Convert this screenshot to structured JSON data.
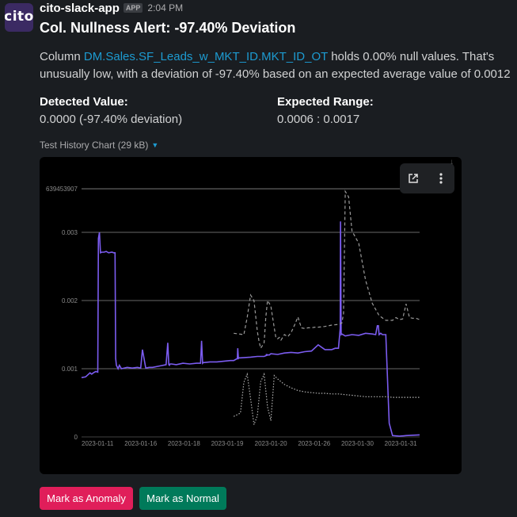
{
  "message": {
    "avatar_text": "cito",
    "sender": "cito-slack-app",
    "badge": "APP",
    "time": "2:04 PM",
    "title": "Col. Nullness Alert: -97.40% Deviation",
    "desc_prefix": "Column ",
    "desc_link": "DM.Sales.SF_Leads_w_MKT_ID.MKT_ID_OT",
    "desc_suffix": " holds 0.00% null values. That's unusually low, with a deviation of -97.40% based on an expected average value of 0.0012",
    "detected_label": "Detected Value:",
    "detected_value": "0.0000 (-97.40% deviation)",
    "expected_label": "Expected Range:",
    "expected_value": "0.0006 : 0.0017",
    "attachment_label": "Test History Chart (29 kB)",
    "colors": {
      "link": "#1d9bd1",
      "anomaly_button": "#e01e5a",
      "normal_button": "#007a5a"
    }
  },
  "chart_data": {
    "type": "line",
    "y_tick_labels": [
      "0",
      "0.001",
      "0.002",
      "0.003",
      "639453907"
    ],
    "y_ticks": [
      0,
      0.001,
      0.002,
      0.003,
      0.0036394539
    ],
    "x_tick_labels": [
      "2023-01-11",
      "2023-01-16",
      "2023-01-18",
      "2023-01-19",
      "2023-01-20",
      "2023-01-26",
      "2023-01-30",
      "2023-01-31"
    ],
    "ylim": [
      0,
      0.00364
    ],
    "grid": true,
    "series": [
      {
        "style": "solid",
        "color": "#7b5cf0",
        "x": [
          0,
          0.012,
          0.025,
          0.03,
          0.035,
          0.042,
          0.048,
          0.05,
          0.053,
          0.056,
          0.06,
          0.066,
          0.073,
          0.08,
          0.09,
          0.095,
          0.099,
          0.101,
          0.103,
          0.108,
          0.112,
          0.118,
          0.135,
          0.15,
          0.165,
          0.175,
          0.18,
          0.19,
          0.2,
          0.21,
          0.23,
          0.25,
          0.255,
          0.258,
          0.26,
          0.262,
          0.266,
          0.28,
          0.3,
          0.32,
          0.34,
          0.35,
          0.352,
          0.355,
          0.358,
          0.36,
          0.38,
          0.4,
          0.42,
          0.44,
          0.45,
          0.461,
          0.462,
          0.464,
          0.466,
          0.47,
          0.5,
          0.52,
          0.54,
          0.55,
          0.55,
          0.545,
          0.555,
          0.56,
          0.58,
          0.6,
          0.62,
          0.64,
          0.66,
          0.68,
          0.7,
          0.72,
          0.74,
          0.75,
          0.76,
          0.765,
          0.766,
          0.768,
          0.77,
          0.78,
          0.8,
          0.82,
          0.84,
          0.86,
          0.87,
          0.875,
          0.878,
          0.88,
          0.885,
          0.89,
          0.9,
          0.91,
          0.92,
          0.94,
          0.96,
          1.0
        ],
        "y": [
          0.00087,
          0.00088,
          0.00094,
          0.00092,
          0.00094,
          0.00096,
          0.00095,
          0.00291,
          0.003,
          0.0027,
          0.00271,
          0.00271,
          0.00272,
          0.0027,
          0.00271,
          0.0027,
          0.0027,
          0.00115,
          0.00105,
          0.001,
          0.00105,
          0.001,
          0.00102,
          0.00101,
          0.00102,
          0.00101,
          0.00128,
          0.00101,
          0.00102,
          0.00102,
          0.00104,
          0.00106,
          0.00138,
          0.00106,
          0.00105,
          0.00107,
          0.00107,
          0.00106,
          0.00108,
          0.00107,
          0.00108,
          0.00108,
          0.00108,
          0.00141,
          0.00108,
          0.00109,
          0.0011,
          0.0011,
          0.00111,
          0.00112,
          0.00112,
          0.00115,
          0.0013,
          0.00115,
          0.00116,
          0.00116,
          0.00117,
          0.00118,
          0.00118,
          0.0012,
          0.0012,
          0.00121,
          0.0012,
          0.00122,
          0.00121,
          0.00123,
          0.00124,
          0.00123,
          0.00125,
          0.00126,
          0.00135,
          0.00128,
          0.00128,
          0.0013,
          0.0013,
          0.00159,
          0.00316,
          0.0015,
          0.00151,
          0.00148,
          0.0015,
          0.00149,
          0.00152,
          0.00151,
          0.0015,
          0.00163,
          0.00163,
          0.0015,
          0.00152,
          0.0015,
          0.0015,
          0.0002,
          2e-05,
          1e-05,
          2e-05,
          3e-05
        ]
      },
      {
        "style": "dashed",
        "color": "#9a9a9a",
        "x": [
          0.45,
          0.48,
          0.49,
          0.5,
          0.51,
          0.52,
          0.525,
          0.53,
          0.54,
          0.545,
          0.55,
          0.56,
          0.57,
          0.575,
          0.58,
          0.585,
          0.59,
          0.6,
          0.61,
          0.62,
          0.63,
          0.64,
          0.65,
          0.66,
          0.67,
          0.68,
          0.69,
          0.7,
          0.72,
          0.74,
          0.76,
          0.77,
          0.775,
          0.78,
          0.79,
          0.8,
          0.82,
          0.84,
          0.86,
          0.88,
          0.9,
          0.92,
          0.93,
          0.94,
          0.95,
          0.96,
          0.97,
          0.98,
          0.99,
          1.0
        ],
        "y": [
          0.00152,
          0.0015,
          0.00175,
          0.00208,
          0.002,
          0.00155,
          0.0014,
          0.0013,
          0.00138,
          0.00175,
          0.002,
          0.00192,
          0.0016,
          0.00145,
          0.00144,
          0.00146,
          0.00142,
          0.0015,
          0.00147,
          0.00153,
          0.00164,
          0.00176,
          0.0016,
          0.00159,
          0.0016,
          0.0016,
          0.00161,
          0.00161,
          0.00162,
          0.00164,
          0.00165,
          0.00167,
          0.00181,
          0.0036,
          0.00352,
          0.00302,
          0.00284,
          0.0023,
          0.00196,
          0.00178,
          0.00171,
          0.00171,
          0.00175,
          0.00172,
          0.00173,
          0.00195,
          0.00175,
          0.00174,
          0.00174,
          0.00172
        ]
      },
      {
        "style": "dotted",
        "color": "#b0b0b0",
        "x": [
          0.45,
          0.47,
          0.48,
          0.49,
          0.5,
          0.51,
          0.52,
          0.53,
          0.54,
          0.55,
          0.56,
          0.57,
          0.58,
          0.6,
          0.62,
          0.64,
          0.66,
          0.68,
          0.7,
          0.72,
          0.74,
          0.76,
          0.78,
          0.8,
          0.82,
          0.84,
          0.86,
          0.88,
          0.9,
          0.92,
          0.94,
          0.96,
          0.98,
          1.0
        ],
        "y": [
          0.0003,
          0.00035,
          0.0008,
          0.00092,
          0.00056,
          0.00018,
          0.00031,
          0.00081,
          0.00092,
          0.00044,
          0.00024,
          0.0009,
          0.00085,
          0.00077,
          0.00072,
          0.00068,
          0.00066,
          0.00065,
          0.00064,
          0.00064,
          0.00063,
          0.00063,
          0.00062,
          0.00061,
          0.0006,
          0.00059,
          0.00059,
          0.00059,
          0.00059,
          0.00058,
          0.00058,
          0.00058,
          0.00058,
          0.00058
        ]
      }
    ]
  },
  "actions": {
    "anomaly_label": "Mark as Anomaly",
    "normal_label": "Mark as Normal"
  }
}
